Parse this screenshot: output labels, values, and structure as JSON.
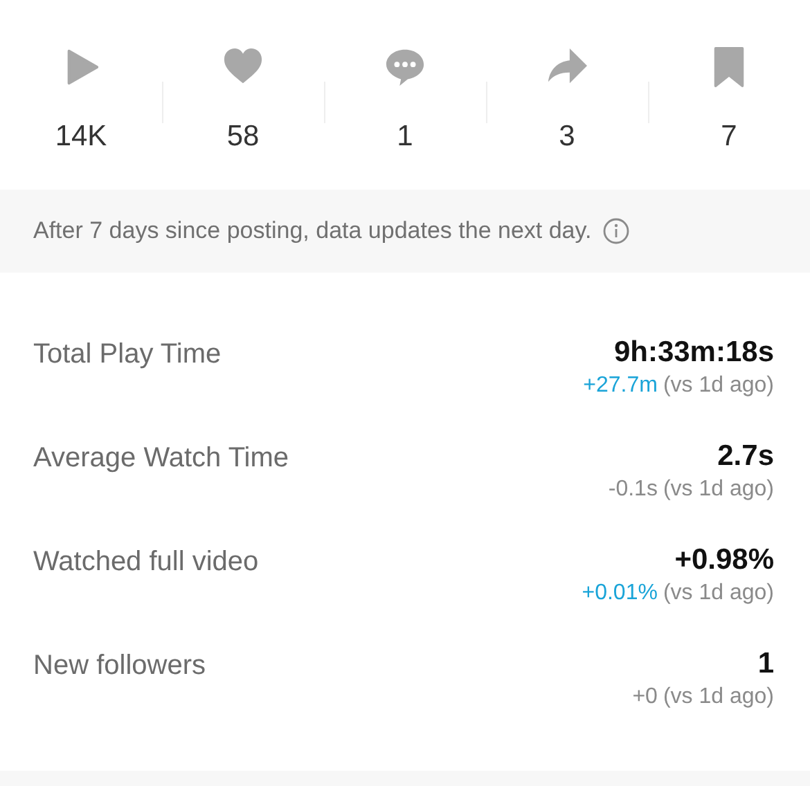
{
  "stats": [
    {
      "kind": "play",
      "count": "14K"
    },
    {
      "kind": "like",
      "count": "58"
    },
    {
      "kind": "comment",
      "count": "1"
    },
    {
      "kind": "share",
      "count": "3"
    },
    {
      "kind": "save",
      "count": "7"
    }
  ],
  "notice": {
    "text": "After 7 days since posting, data updates the next day."
  },
  "metrics": [
    {
      "label": "Total Play Time",
      "value": "9h:33m:18s",
      "delta": "+27.7m",
      "kind": "up",
      "compare": "(vs 1d ago)"
    },
    {
      "label": "Average Watch Time",
      "value": "2.7s",
      "delta": "-0.1s",
      "kind": "flat",
      "compare": "(vs 1d ago)"
    },
    {
      "label": "Watched full video",
      "value": "+0.98%",
      "delta": "+0.01%",
      "kind": "up",
      "compare": "(vs 1d ago)"
    },
    {
      "label": "New followers",
      "value": "1",
      "delta": "+0",
      "kind": "flat",
      "compare": "(vs 1d ago)"
    }
  ]
}
